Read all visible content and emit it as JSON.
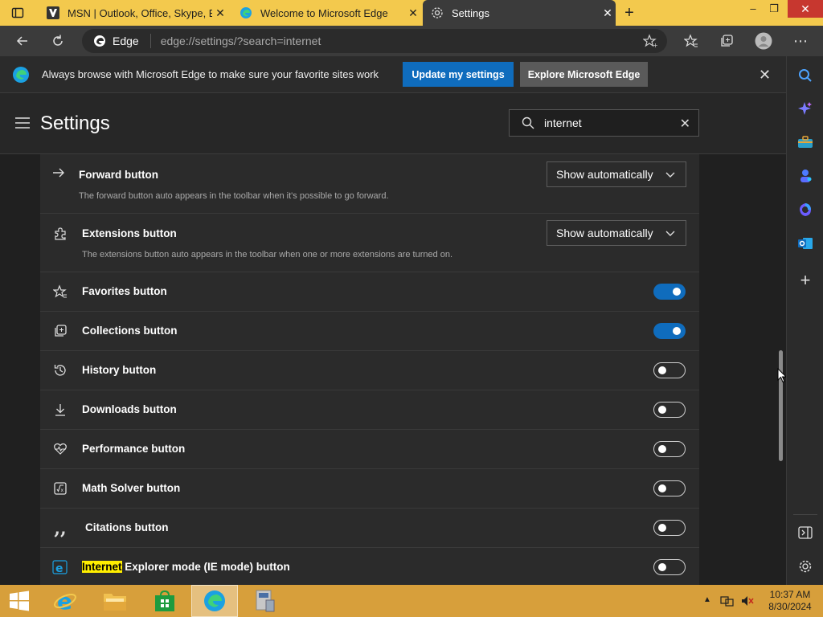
{
  "tabs": [
    {
      "title": "MSN | Outlook, Office, Skype, Bi"
    },
    {
      "title": "Welcome to Microsoft Edge"
    },
    {
      "title": "Settings"
    }
  ],
  "address": {
    "site_label": "Edge",
    "url": "edge://settings/?search=internet"
  },
  "banner": {
    "message": "Always browse with Microsoft Edge to make sure your favorite sites work",
    "primary_button": "Update my settings",
    "secondary_button": "Explore Microsoft Edge"
  },
  "settings": {
    "title": "Settings",
    "search_value": "internet"
  },
  "rows": [
    {
      "label": "Forward button",
      "desc": "The forward button auto appears in the toolbar when it's possible to go forward.",
      "control": "dropdown",
      "value": "Show automatically",
      "icon": "arrow-right-icon"
    },
    {
      "label": "Extensions button",
      "desc": "The extensions button auto appears in the toolbar when one or more extensions are turned on.",
      "control": "dropdown",
      "value": "Show automatically",
      "icon": "puzzle-icon"
    },
    {
      "label": "Favorites button",
      "control": "toggle",
      "on": true,
      "icon": "favorites-star-icon"
    },
    {
      "label": "Collections button",
      "control": "toggle",
      "on": true,
      "icon": "collections-icon"
    },
    {
      "label": "History button",
      "control": "toggle",
      "on": false,
      "icon": "history-icon"
    },
    {
      "label": "Downloads button",
      "control": "toggle",
      "on": false,
      "icon": "download-icon"
    },
    {
      "label": "Performance button",
      "control": "toggle",
      "on": false,
      "icon": "heartbeat-icon"
    },
    {
      "label": "Math Solver button",
      "control": "toggle",
      "on": false,
      "icon": "math-icon"
    },
    {
      "label": "Citations button",
      "control": "toggle",
      "on": false,
      "icon": "quote-icon"
    },
    {
      "label_highlight": "Internet",
      "label_rest": " Explorer mode (IE mode) button",
      "control": "toggle",
      "on": false,
      "icon": "ie-icon"
    }
  ],
  "clock": {
    "time": "10:37 AM",
    "date": "8/30/2024"
  },
  "colors": {
    "accent": "#0f6cbd",
    "tabbar": "#f3c94d",
    "taskbar": "#d79f3b",
    "highlight": "#ffee00"
  }
}
